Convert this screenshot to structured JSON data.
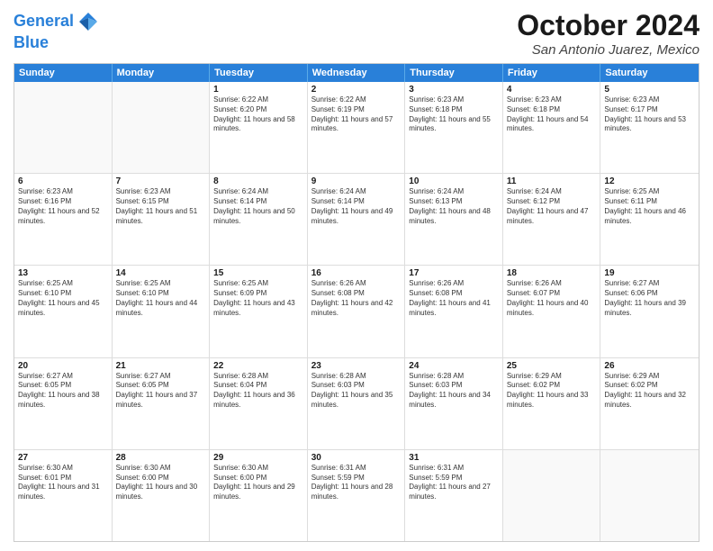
{
  "logo": {
    "line1": "General",
    "line2": "Blue"
  },
  "title": "October 2024",
  "subtitle": "San Antonio Juarez, Mexico",
  "header_days": [
    "Sunday",
    "Monday",
    "Tuesday",
    "Wednesday",
    "Thursday",
    "Friday",
    "Saturday"
  ],
  "weeks": [
    [
      {
        "day": "",
        "info": ""
      },
      {
        "day": "",
        "info": ""
      },
      {
        "day": "1",
        "info": "Sunrise: 6:22 AM\nSunset: 6:20 PM\nDaylight: 11 hours and 58 minutes."
      },
      {
        "day": "2",
        "info": "Sunrise: 6:22 AM\nSunset: 6:19 PM\nDaylight: 11 hours and 57 minutes."
      },
      {
        "day": "3",
        "info": "Sunrise: 6:23 AM\nSunset: 6:18 PM\nDaylight: 11 hours and 55 minutes."
      },
      {
        "day": "4",
        "info": "Sunrise: 6:23 AM\nSunset: 6:18 PM\nDaylight: 11 hours and 54 minutes."
      },
      {
        "day": "5",
        "info": "Sunrise: 6:23 AM\nSunset: 6:17 PM\nDaylight: 11 hours and 53 minutes."
      }
    ],
    [
      {
        "day": "6",
        "info": "Sunrise: 6:23 AM\nSunset: 6:16 PM\nDaylight: 11 hours and 52 minutes."
      },
      {
        "day": "7",
        "info": "Sunrise: 6:23 AM\nSunset: 6:15 PM\nDaylight: 11 hours and 51 minutes."
      },
      {
        "day": "8",
        "info": "Sunrise: 6:24 AM\nSunset: 6:14 PM\nDaylight: 11 hours and 50 minutes."
      },
      {
        "day": "9",
        "info": "Sunrise: 6:24 AM\nSunset: 6:14 PM\nDaylight: 11 hours and 49 minutes."
      },
      {
        "day": "10",
        "info": "Sunrise: 6:24 AM\nSunset: 6:13 PM\nDaylight: 11 hours and 48 minutes."
      },
      {
        "day": "11",
        "info": "Sunrise: 6:24 AM\nSunset: 6:12 PM\nDaylight: 11 hours and 47 minutes."
      },
      {
        "day": "12",
        "info": "Sunrise: 6:25 AM\nSunset: 6:11 PM\nDaylight: 11 hours and 46 minutes."
      }
    ],
    [
      {
        "day": "13",
        "info": "Sunrise: 6:25 AM\nSunset: 6:10 PM\nDaylight: 11 hours and 45 minutes."
      },
      {
        "day": "14",
        "info": "Sunrise: 6:25 AM\nSunset: 6:10 PM\nDaylight: 11 hours and 44 minutes."
      },
      {
        "day": "15",
        "info": "Sunrise: 6:25 AM\nSunset: 6:09 PM\nDaylight: 11 hours and 43 minutes."
      },
      {
        "day": "16",
        "info": "Sunrise: 6:26 AM\nSunset: 6:08 PM\nDaylight: 11 hours and 42 minutes."
      },
      {
        "day": "17",
        "info": "Sunrise: 6:26 AM\nSunset: 6:08 PM\nDaylight: 11 hours and 41 minutes."
      },
      {
        "day": "18",
        "info": "Sunrise: 6:26 AM\nSunset: 6:07 PM\nDaylight: 11 hours and 40 minutes."
      },
      {
        "day": "19",
        "info": "Sunrise: 6:27 AM\nSunset: 6:06 PM\nDaylight: 11 hours and 39 minutes."
      }
    ],
    [
      {
        "day": "20",
        "info": "Sunrise: 6:27 AM\nSunset: 6:05 PM\nDaylight: 11 hours and 38 minutes."
      },
      {
        "day": "21",
        "info": "Sunrise: 6:27 AM\nSunset: 6:05 PM\nDaylight: 11 hours and 37 minutes."
      },
      {
        "day": "22",
        "info": "Sunrise: 6:28 AM\nSunset: 6:04 PM\nDaylight: 11 hours and 36 minutes."
      },
      {
        "day": "23",
        "info": "Sunrise: 6:28 AM\nSunset: 6:03 PM\nDaylight: 11 hours and 35 minutes."
      },
      {
        "day": "24",
        "info": "Sunrise: 6:28 AM\nSunset: 6:03 PM\nDaylight: 11 hours and 34 minutes."
      },
      {
        "day": "25",
        "info": "Sunrise: 6:29 AM\nSunset: 6:02 PM\nDaylight: 11 hours and 33 minutes."
      },
      {
        "day": "26",
        "info": "Sunrise: 6:29 AM\nSunset: 6:02 PM\nDaylight: 11 hours and 32 minutes."
      }
    ],
    [
      {
        "day": "27",
        "info": "Sunrise: 6:30 AM\nSunset: 6:01 PM\nDaylight: 11 hours and 31 minutes."
      },
      {
        "day": "28",
        "info": "Sunrise: 6:30 AM\nSunset: 6:00 PM\nDaylight: 11 hours and 30 minutes."
      },
      {
        "day": "29",
        "info": "Sunrise: 6:30 AM\nSunset: 6:00 PM\nDaylight: 11 hours and 29 minutes."
      },
      {
        "day": "30",
        "info": "Sunrise: 6:31 AM\nSunset: 5:59 PM\nDaylight: 11 hours and 28 minutes."
      },
      {
        "day": "31",
        "info": "Sunrise: 6:31 AM\nSunset: 5:59 PM\nDaylight: 11 hours and 27 minutes."
      },
      {
        "day": "",
        "info": ""
      },
      {
        "day": "",
        "info": ""
      }
    ]
  ]
}
